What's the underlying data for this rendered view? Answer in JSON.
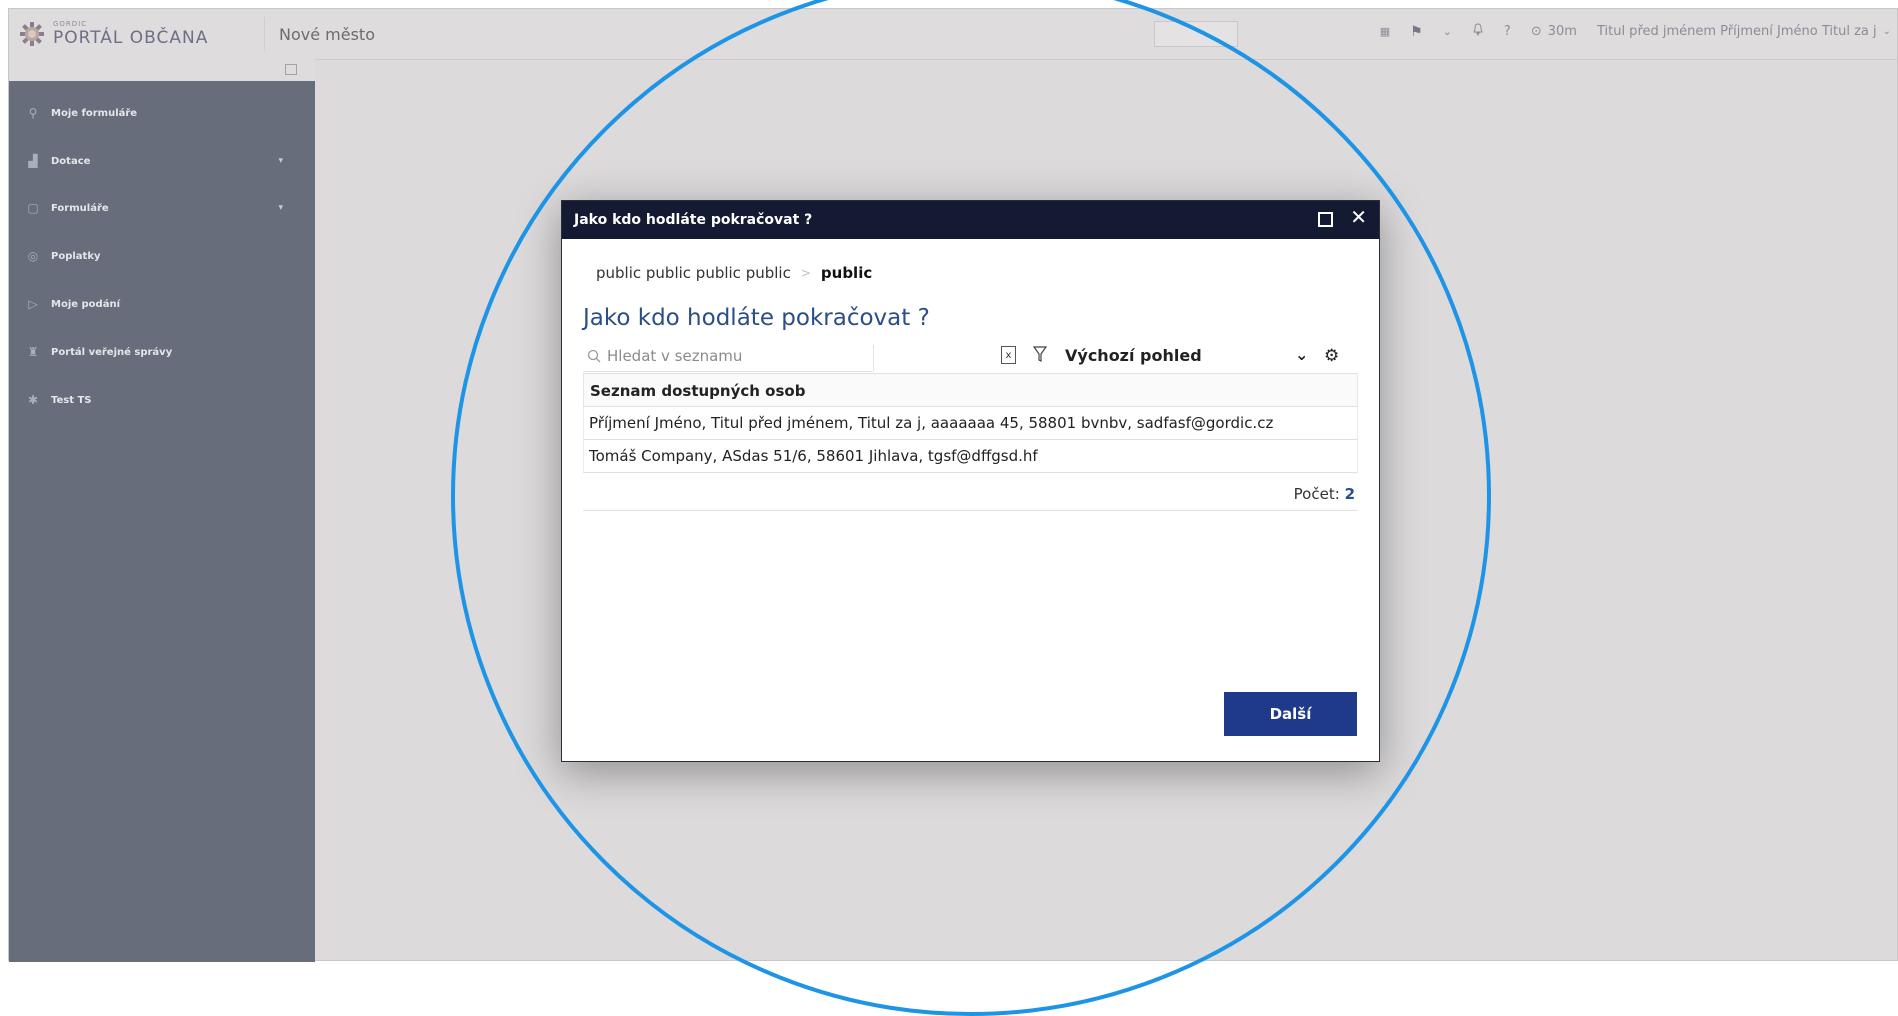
{
  "app": {
    "logo_small": "GORDIC",
    "logo_main": "PORTÁL OBČANA",
    "page_title": "Nové město"
  },
  "topbar": {
    "timer": "30m",
    "user_name": "Titul před jménem Příjmení Jméno Titul za j",
    "help": "?"
  },
  "sidebar": {
    "items": [
      {
        "label": "Moje formuláře",
        "icon": "search-doc-icon",
        "has_chevron": false
      },
      {
        "label": "Dotace",
        "icon": "chart-icon",
        "has_chevron": true
      },
      {
        "label": "Formuláře",
        "icon": "document-icon",
        "has_chevron": true
      },
      {
        "label": "Poplatky",
        "icon": "coins-icon",
        "has_chevron": false
      },
      {
        "label": "Moje podání",
        "icon": "document-arrow-icon",
        "has_chevron": false
      },
      {
        "label": "Portál veřejné správy",
        "icon": "emblem-icon",
        "has_chevron": false
      },
      {
        "label": "Test TS",
        "icon": "star-icon",
        "has_chevron": false
      }
    ]
  },
  "modal": {
    "title": "Jako kdo hodláte pokračovat ?",
    "breadcrumb": {
      "parent": "public public public public",
      "current": "public"
    },
    "heading": "Jako kdo hodláte pokračovat ?",
    "search_placeholder": "Hledat v seznamu",
    "view_label": "Výchozí pohled",
    "table_header": "Seznam dostupných osob",
    "rows": [
      "Příjmení Jméno, Titul před jménem, Titul za j, aaaaaaa 45, 58801 bvnbv, sadfasf@gordic.cz",
      "Tomáš Company, ASdas 51/6, 58601 Jihlava, tgsf@dffgsd.hf"
    ],
    "count_label": "Počet:",
    "count_value": "2",
    "next_button": "Další"
  },
  "colors": {
    "modal_header": "#141a32",
    "primary_button": "#1f3a8a",
    "heading": "#2a4e86",
    "sidebar": "#676d7a",
    "highlight_circle": "#1e94e6"
  }
}
